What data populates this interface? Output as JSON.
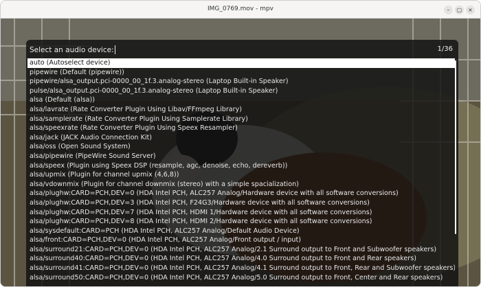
{
  "window": {
    "title": "IMG_0769.mov - mpv",
    "minimize_icon": "–",
    "maximize_icon": "▢",
    "close_icon": "×"
  },
  "selector": {
    "prompt": "Select an audio device:",
    "counter": "1/36",
    "items": [
      "auto (Autoselect device)",
      "pipewire (Default (pipewire))",
      "pipewire/alsa_output.pci-0000_00_1f.3.analog-stereo (Laptop Built-in Speaker)",
      "pulse/alsa_output.pci-0000_00_1f.3.analog-stereo (Laptop Built-in Speaker)",
      "alsa (Default (alsa))",
      "alsa/lavrate (Rate Converter Plugin Using Libav/FFmpeg Library)",
      "alsa/samplerate (Rate Converter Plugin Using Samplerate Library)",
      "alsa/speexrate (Rate Converter Plugin Using Speex Resampler)",
      "alsa/jack (JACK Audio Connection Kit)",
      "alsa/oss (Open Sound System)",
      "alsa/pipewire (PipeWire Sound Server)",
      "alsa/speex (Plugin using Speex DSP (resample, agc, denoise, echo, dereverb))",
      "alsa/upmix (Plugin for channel upmix (4,6,8))",
      "alsa/vdownmix (Plugin for channel downmix (stereo) with a simple spacialization)",
      "alsa/plughw:CARD=PCH,DEV=0 (HDA Intel PCH, ALC257 Analog/Hardware device with all software conversions)",
      "alsa/plughw:CARD=PCH,DEV=3 (HDA Intel PCH, F24G3/Hardware device with all software conversions)",
      "alsa/plughw:CARD=PCH,DEV=7 (HDA Intel PCH, HDMI 1/Hardware device with all software conversions)",
      "alsa/plughw:CARD=PCH,DEV=8 (HDA Intel PCH, HDMI 2/Hardware device with all software conversions)",
      "alsa/sysdefault:CARD=PCH (HDA Intel PCH, ALC257 Analog/Default Audio Device)",
      "alsa/front:CARD=PCH,DEV=0 (HDA Intel PCH, ALC257 Analog/Front output / input)",
      "alsa/surround21:CARD=PCH,DEV=0 (HDA Intel PCH, ALC257 Analog/2.1 Surround output to Front and Subwoofer speakers)",
      "alsa/surround40:CARD=PCH,DEV=0 (HDA Intel PCH, ALC257 Analog/4.0 Surround output to Front and Rear speakers)",
      "alsa/surround41:CARD=PCH,DEV=0 (HDA Intel PCH, ALC257 Analog/4.1 Surround output to Front, Rear and Subwoofer speakers)",
      "alsa/surround50:CARD=PCH,DEV=0 (HDA Intel PCH, ALC257 Analog/5.0 Surround output to Front, Center and Rear speakers)"
    ],
    "selected_index": 0
  },
  "colors": {
    "overlay_bg": "#121212",
    "selected_bg": "#ffffff",
    "text": "#e8e8e8"
  }
}
